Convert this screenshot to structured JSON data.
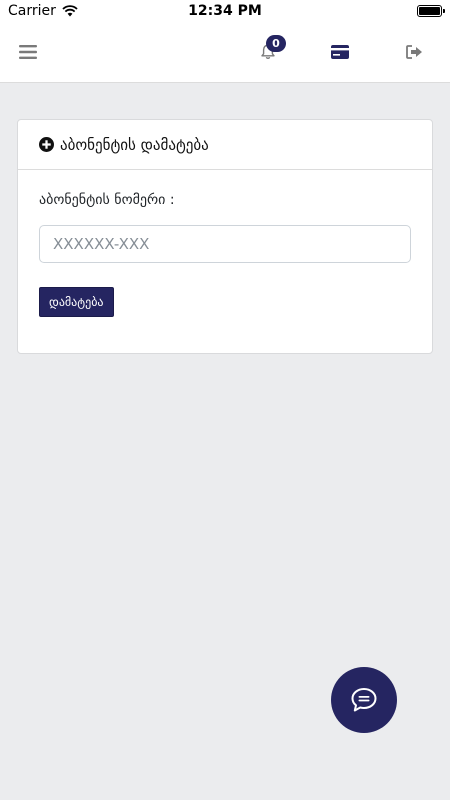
{
  "status_bar": {
    "carrier": "Carrier",
    "time": "12:34 PM"
  },
  "nav": {
    "notification_count": "0"
  },
  "card": {
    "title": "აბონენტის დამატება",
    "field_label": "აბონენტის ნომერი :",
    "input_placeholder": "XXXXXX-XXX",
    "input_value": "",
    "add_button_label": "დამატება"
  },
  "colors": {
    "brand": "#252561",
    "background": "#ebecee",
    "nav_icon": "#7a7a7a"
  },
  "icons": {
    "menu": "hamburger-icon",
    "notifications": "bell-icon",
    "card": "credit-card-icon",
    "logout": "logout-icon",
    "add": "plus-circle-icon",
    "chat": "chat-bubble-icon"
  }
}
